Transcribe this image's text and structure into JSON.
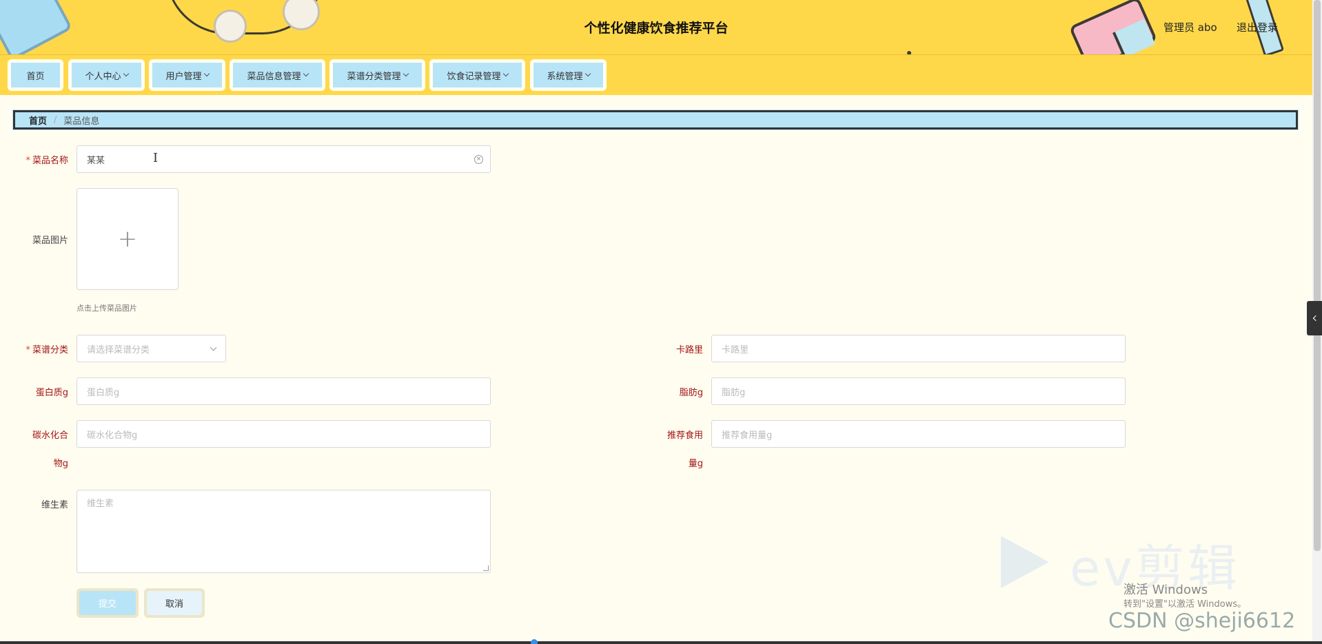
{
  "header": {
    "title": "个性化健康饮食推荐平台",
    "user_label": "管理员 abo",
    "logout_label": "退出登录"
  },
  "nav": {
    "items": [
      {
        "label": "首页"
      },
      {
        "label": "个人中心"
      },
      {
        "label": "用户管理"
      },
      {
        "label": "菜品信息管理"
      },
      {
        "label": "菜谱分类管理"
      },
      {
        "label": "饮食记录管理"
      },
      {
        "label": "系统管理"
      }
    ]
  },
  "breadcrumb": {
    "home": "首页",
    "separator": "/",
    "current": "菜品信息"
  },
  "form": {
    "name": {
      "label": "菜品名称",
      "required_mark": "*",
      "value": "某某"
    },
    "image": {
      "label": "菜品图片",
      "hint": "点击上传菜品图片",
      "plus": "+"
    },
    "category": {
      "label": "菜谱分类",
      "required_mark": "*",
      "placeholder": "请选择菜谱分类"
    },
    "calories": {
      "label": "卡路里",
      "placeholder": "卡路里"
    },
    "protein": {
      "label": "蛋白质g",
      "placeholder": "蛋白质g"
    },
    "fat": {
      "label": "脂肪g",
      "placeholder": "脂肪g"
    },
    "carbs": {
      "label_line1": "碳水化合",
      "label_line2": "物g",
      "placeholder": "碳水化合物g"
    },
    "recommended": {
      "label_line1": "推荐食用",
      "label_line2": "量g",
      "placeholder": "推荐食用量g"
    },
    "vitamin": {
      "label": "维生素",
      "placeholder": "维生素"
    },
    "submit_label": "提交",
    "cancel_label": "取消"
  },
  "watermarks": {
    "ev": "ev剪辑",
    "activate_title": "激活 Windows",
    "activate_sub": "转到\"设置\"以激活 Windows。",
    "csdn": "CSDN @sheji6612"
  },
  "colors": {
    "header_bg": "#ffd84a",
    "nav_tab_bg": "#b8e4f7",
    "page_bg": "#fffdf0",
    "label_red": "#a31515"
  }
}
